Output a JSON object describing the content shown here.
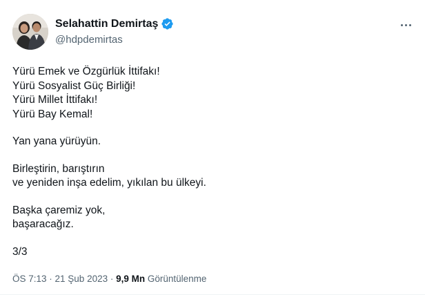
{
  "author": {
    "name": "Selahattin Demirtaş",
    "handle": "@hdpdemirtas",
    "verified_icon": "verified-badge-icon",
    "verified_color": "#1d9bf0"
  },
  "tweet": {
    "paragraphs": [
      [
        "Yürü Emek ve Özgürlük İttifakı!",
        "Yürü Sosyalist Güç Birliği!",
        "Yürü Millet İttifakı!",
        "Yürü Bay Kemal!"
      ],
      [
        "Yan yana yürüyün."
      ],
      [
        "Birleştirin, barıştırın",
        "ve yeniden inşa edelim, yıkılan bu ülkeyi."
      ],
      [
        "Başka çaremiz yok,",
        "başaracağız."
      ],
      [
        "3/3"
      ]
    ]
  },
  "meta": {
    "time": "ÖS 7:13",
    "separator": " · ",
    "date": "21 Şub 2023",
    "views_count": "9,9 Mn",
    "views_label": "Görüntülenme"
  }
}
